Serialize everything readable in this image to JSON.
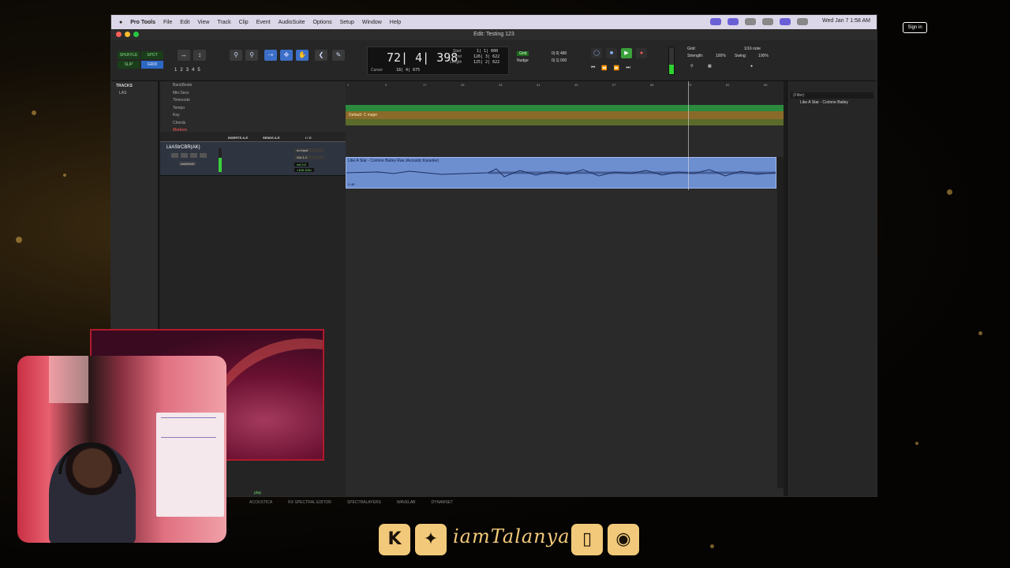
{
  "menubar": {
    "apple": "",
    "app": "Pro Tools",
    "items": [
      "File",
      "Edit",
      "View",
      "Track",
      "Clip",
      "Event",
      "AudioSuite",
      "Options",
      "Setup",
      "Window",
      "Help"
    ],
    "clock": "Wed Jan 7  1:58 AM"
  },
  "window": {
    "title": "Edit: Testing 123"
  },
  "toolbar": {
    "modes": [
      "SHUFFLE",
      "SPOT",
      "SLIP",
      "GRID"
    ],
    "numbers": [
      "1",
      "2",
      "3",
      "4",
      "5"
    ],
    "counter_main": "72| 4| 398",
    "cursor_label": "Cursor",
    "cursor_value": "18| 4| 675",
    "start_label": "Start",
    "end_label": "End",
    "length_label": "Length",
    "start_value": "1| 1| 000",
    "end_value": "126| 3| 622",
    "length_value": "125| 2| 622",
    "grid_label": "Grid",
    "nudge_label": "Nudge",
    "grid_value": "0| 0| 480",
    "nudge_value": "0| 1| 000",
    "grid_right": "Grid:",
    "grid_note": "1/16 note",
    "strength_label": "Strength:",
    "strength_value": "100%",
    "swing_label": "Swing:",
    "swing_value": "100%"
  },
  "tracks_panel": {
    "header": "TRACKS",
    "item": "LAS"
  },
  "rulers": [
    "Bars|Beats",
    "Min:Secs",
    "Timecode",
    "Tempo",
    "Key",
    "Chords",
    "Markers"
  ],
  "ruler_numbers": [
    "1",
    "9",
    "17",
    "25",
    "33",
    "41",
    "49",
    "57",
    "65",
    "73",
    "81",
    "89"
  ],
  "io_header": {
    "inserts": "INSERTS A-E",
    "sends": "SENDS A-E",
    "io": "I / O"
  },
  "track": {
    "name": "LkAStrCBR(AK)",
    "mode": "waveform",
    "input": "no input",
    "output": "Out 1-2",
    "vol": "vol",
    "vol_value": "0.0",
    "pan": "<100",
    "pan_value": "100>"
  },
  "key_lane": "Default: C major",
  "region": {
    "name": "Like A Star - Corinne Bailey Rae (Acoustic Karaoke)",
    "gain": "0 dB"
  },
  "clips": {
    "filter": "(Filter)",
    "item": "Like A Star - Corinne Bailey"
  },
  "plugins": [
    "ACOUSTICA",
    "RX SPECTRAL EDITOR",
    "SPECTRALAYERS",
    "WAVELAB",
    "DYNAMSET"
  ],
  "play_label": "play",
  "social": {
    "handle": "iamTalanya"
  },
  "signin": "Sign in"
}
